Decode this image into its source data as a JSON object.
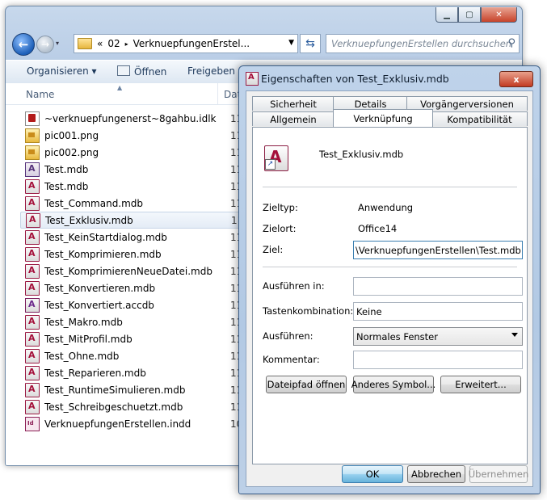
{
  "explorer": {
    "nav": {
      "history_chevron": "▾"
    },
    "address": {
      "prefix": "«",
      "segments": [
        "02",
        "VerknuepfungenErstel..."
      ]
    },
    "search": {
      "placeholder": "VerknuepfungenErstellen durchsuchen"
    },
    "toolbar": {
      "organize": "Organisieren ▾",
      "open": "Öffnen",
      "share": "Freigeben fü"
    },
    "columns": {
      "name": "Name",
      "date": "Dat"
    },
    "files": [
      {
        "name": "~verknuepfungenerst~8gahbu.idlk",
        "date": "11.",
        "icon": "lock-file-icon"
      },
      {
        "name": "pic001.png",
        "date": "11.",
        "icon": "png-icon"
      },
      {
        "name": "pic002.png",
        "date": "11.",
        "icon": "png-icon"
      },
      {
        "name": "Test.mdb",
        "date": "11.",
        "icon": "access-mdb-icon"
      },
      {
        "name": "Test.mdb",
        "date": "11.",
        "icon": "access-mdb-icon"
      },
      {
        "name": "Test_Command.mdb",
        "date": "11.",
        "icon": "access-shortcut-icon"
      },
      {
        "name": "Test_Exklusiv.mdb",
        "date": "11.",
        "icon": "access-shortcut-icon"
      },
      {
        "name": "Test_KeinStartdialog.mdb",
        "date": "11.",
        "icon": "access-shortcut-icon"
      },
      {
        "name": "Test_Komprimieren.mdb",
        "date": "11.",
        "icon": "access-shortcut-icon"
      },
      {
        "name": "Test_KomprimierenNeueDatei.mdb",
        "date": "11.",
        "icon": "access-shortcut-icon"
      },
      {
        "name": "Test_Konvertieren.mdb",
        "date": "11.",
        "icon": "access-shortcut-icon"
      },
      {
        "name": "Test_Konvertiert.accdb",
        "date": "11.",
        "icon": "access-accdb-icon"
      },
      {
        "name": "Test_Makro.mdb",
        "date": "11.",
        "icon": "access-shortcut-icon"
      },
      {
        "name": "Test_MitProfil.mdb",
        "date": "11.",
        "icon": "access-shortcut-icon"
      },
      {
        "name": "Test_Ohne.mdb",
        "date": "11.",
        "icon": "access-shortcut-icon"
      },
      {
        "name": "Test_Reparieren.mdb",
        "date": "11.",
        "icon": "access-shortcut-icon"
      },
      {
        "name": "Test_RuntimeSimulieren.mdb",
        "date": "11.",
        "icon": "access-shortcut-icon"
      },
      {
        "name": "Test_Schreibgeschuetzt.mdb",
        "date": "11.",
        "icon": "access-shortcut-icon"
      },
      {
        "name": "VerknuepfungenErstellen.indd",
        "date": "10.",
        "icon": "indesign-icon"
      }
    ],
    "selected_file": "Test_Exklusiv.mdb"
  },
  "dialog": {
    "title": "Eigenschaften von Test_Exklusiv.mdb",
    "close_label": "x",
    "tabs_row1": [
      "Sicherheit",
      "Details",
      "Vorgängerversionen"
    ],
    "tabs_row2": [
      "Allgemein",
      "Verknüpfung",
      "Kompatibilität"
    ],
    "active_tab": "Verknüpfung",
    "filename": "Test_Exklusiv.mdb",
    "fields": {
      "zieltyp_label": "Zieltyp:",
      "zieltyp_value": "Anwendung",
      "zielort_label": "Zielort:",
      "zielort_value": "Office14",
      "ziel_label": "Ziel:",
      "ziel_value": "\\VerknuepfungenErstellen\\Test.mdb\" /excl",
      "ausfuehren_in_label": "Ausführen in:",
      "ausfuehren_in_value": "",
      "tastenkombination_label": "Tastenkombination:",
      "tastenkombination_value": "Keine",
      "ausfuehren_label": "Ausführen:",
      "ausfuehren_value": "Normales Fenster",
      "kommentar_label": "Kommentar:",
      "kommentar_value": ""
    },
    "buttons": {
      "open_path": "Dateipfad öffnen",
      "change_icon": "Anderes Symbol...",
      "advanced": "Erweitert...",
      "ok": "OK",
      "cancel": "Abbrechen",
      "apply": "Übernehmen"
    }
  }
}
